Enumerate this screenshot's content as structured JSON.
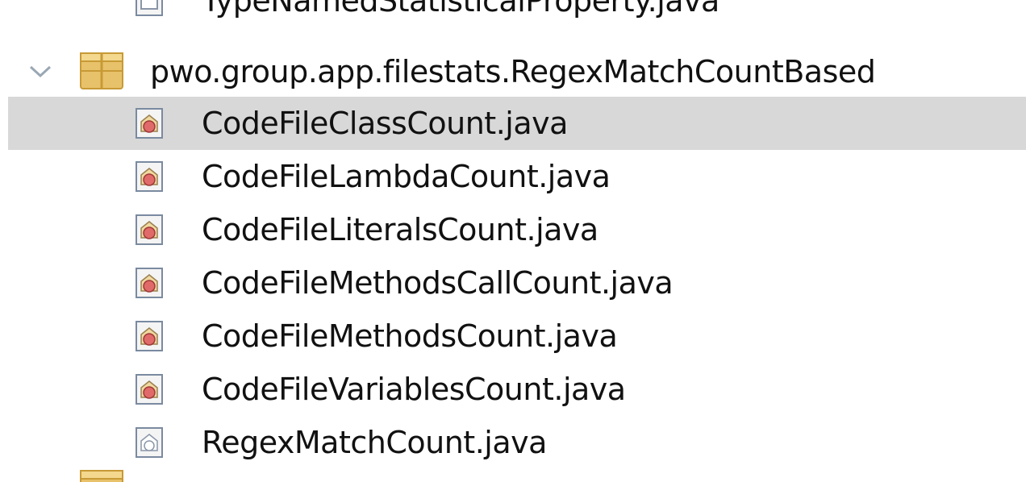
{
  "tree": {
    "partial_top_item": "TypeNamedStatisticalProperty.java",
    "package": {
      "label": "pwo.group.app.filestats.RegexMatchCountBased",
      "expanded": true
    },
    "files": [
      {
        "label": "CodeFileClassCount.java",
        "icon": "java-class-file-icon",
        "selected": true
      },
      {
        "label": "CodeFileLambdaCount.java",
        "icon": "java-class-file-icon",
        "selected": false
      },
      {
        "label": "CodeFileLiteralsCount.java",
        "icon": "java-class-file-icon",
        "selected": false
      },
      {
        "label": "CodeFileMethodsCallCount.java",
        "icon": "java-class-file-icon",
        "selected": false
      },
      {
        "label": "CodeFileMethodsCount.java",
        "icon": "java-class-file-icon",
        "selected": false
      },
      {
        "label": "CodeFileVariablesCount.java",
        "icon": "java-class-file-icon",
        "selected": false
      },
      {
        "label": "RegexMatchCount.java",
        "icon": "java-interface-file-icon",
        "selected": false
      }
    ]
  },
  "colors": {
    "selection": "#d8d8d8",
    "text": "#111111",
    "package_icon": "#e8c26a",
    "class_badge": "#e06a6a"
  }
}
